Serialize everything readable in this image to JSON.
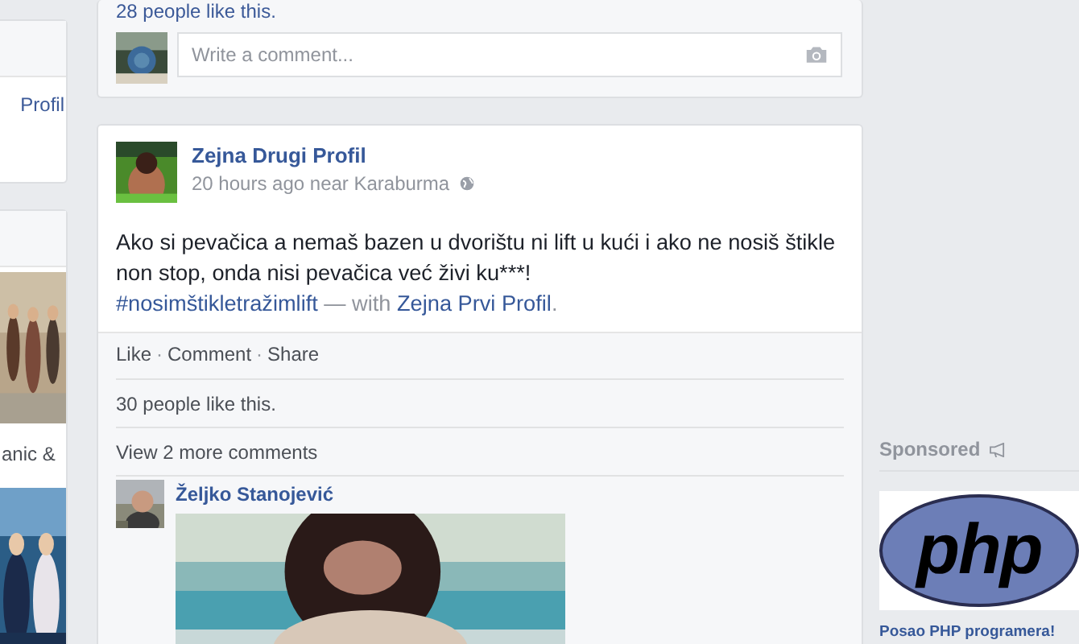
{
  "left_column": {
    "profile_link": "Profil",
    "page_caption": "anic &"
  },
  "previous_post": {
    "likes": "28 people like this.",
    "comment_field": {
      "placeholder": "Write a comment..."
    }
  },
  "post": {
    "author": "Zejna Drugi Profil",
    "meta": "20 hours ago near Karaburma",
    "text": "Ako si pevačica a nemaš bazen u dvorištu ni lift u kući i ako ne nosiš štikle non stop, onda nisi pevačica već živi ku***!",
    "hashtag": "#nosimštikletražimlift",
    "with_label": "— with",
    "tagged": "Zejna Prvi Profil",
    "tag_end": ".",
    "actions": [
      "Like",
      "Comment",
      "Share"
    ],
    "action_separator": "·",
    "likes": "30 people like this.",
    "view_more": "View 2 more comments",
    "comment": {
      "author": "Željko Stanojević",
      "kind": "picture"
    }
  },
  "sponsored": {
    "label": "Sponsored",
    "ad_logo": "php",
    "ad_title": "Posao PHP programera!"
  }
}
